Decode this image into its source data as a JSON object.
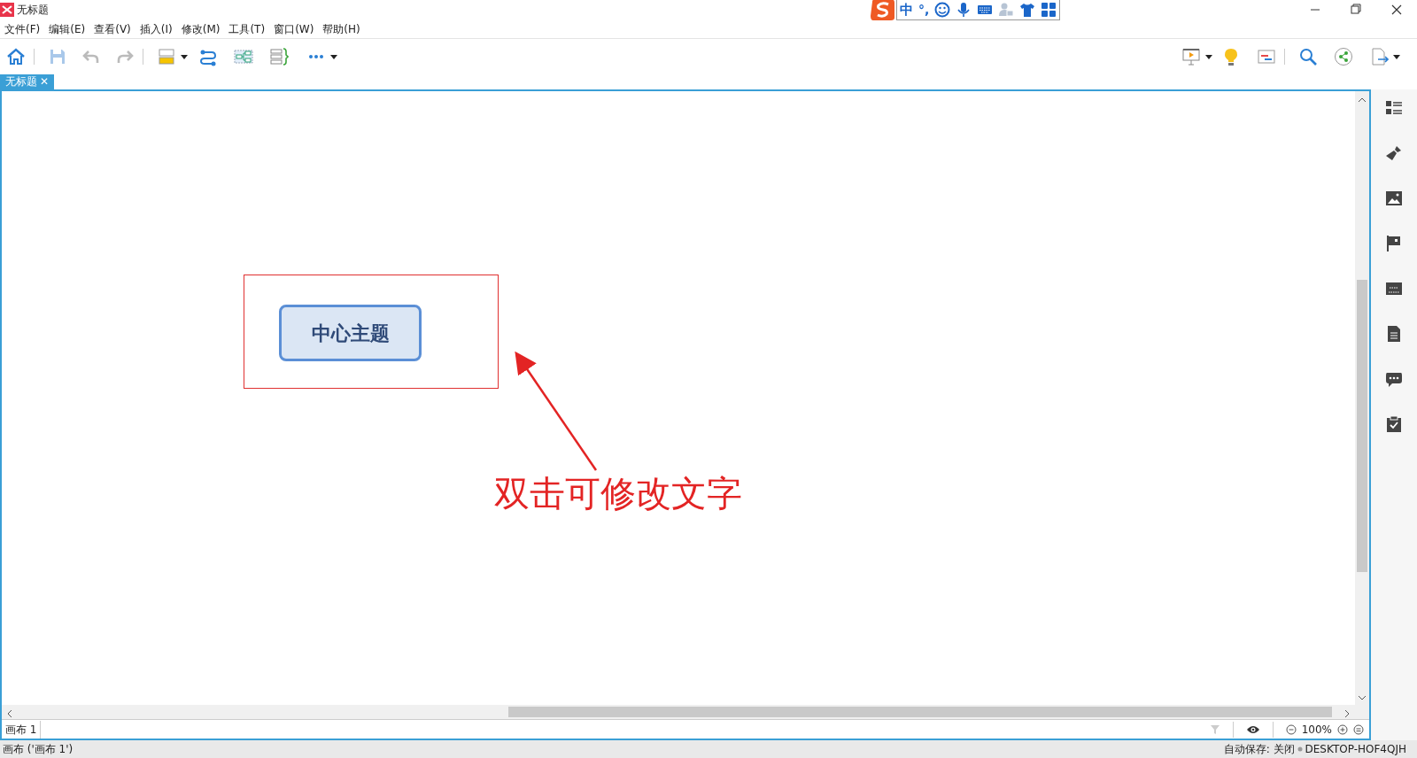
{
  "window": {
    "title": "无标题"
  },
  "menu": [
    "文件(F)",
    "编辑(E)",
    "查看(V)",
    "插入(I)",
    "修改(M)",
    "工具(T)",
    "窗口(W)",
    "帮助(H)"
  ],
  "ime": {
    "mode": "中",
    "punct": "°,"
  },
  "document_tabs": [
    {
      "label": "无标题",
      "close": "✕",
      "selected": true
    }
  ],
  "canvas": {
    "central_topic": "中心主题",
    "annotation": "双击可修改文字"
  },
  "sheet_tabs": [
    {
      "label": "画布 1",
      "selected": true
    }
  ],
  "zoom": "100%",
  "status_bar": {
    "left": "画布 ('画布 1')",
    "autosave": "自动保存: 关闭",
    "computer": "DESKTOP-HOF4QJH"
  }
}
